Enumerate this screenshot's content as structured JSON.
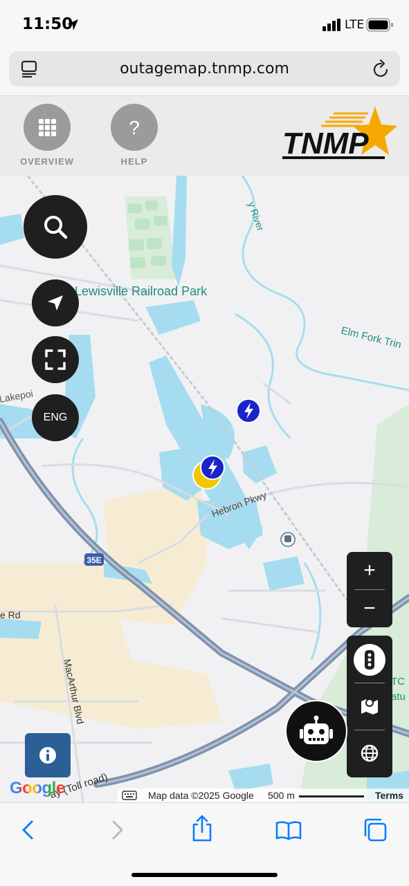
{
  "status_bar": {
    "time": "11:50",
    "network": "LTE"
  },
  "browser": {
    "url": "outagemap.tnmp.com"
  },
  "header": {
    "overview_label": "OVERVIEW",
    "help_label": "HELP",
    "logo_text": "TNMP"
  },
  "map": {
    "labels": {
      "park": "Lewisville Railroad Park",
      "river_top": "y River",
      "elm_fork": "Elm Fork Trin",
      "lakepoint": "Lakepoi",
      "hebron": "Hebron Pkwy",
      "interstate": "35E",
      "rd": "e Rd",
      "macarthur": "MacArthur Blvd",
      "tollroad": "ay (Toll road)",
      "tc": "TC",
      "atu": "atu"
    },
    "controls": {
      "language": "ENG",
      "zoom_in": "+",
      "zoom_out": "−"
    },
    "attribution": {
      "google": "Google",
      "map_data": "Map data ©2025 Google",
      "scale": "500 m",
      "terms": "Terms"
    }
  },
  "colors": {
    "water": "#a6dcef",
    "highway": "#7f93ad",
    "outage_marker": "#1a24c9",
    "crew_marker": "#f2c500",
    "control_bg": "#1f1f1f",
    "safari_blue": "#0a7cff",
    "logo_orange": "#f5a800"
  }
}
